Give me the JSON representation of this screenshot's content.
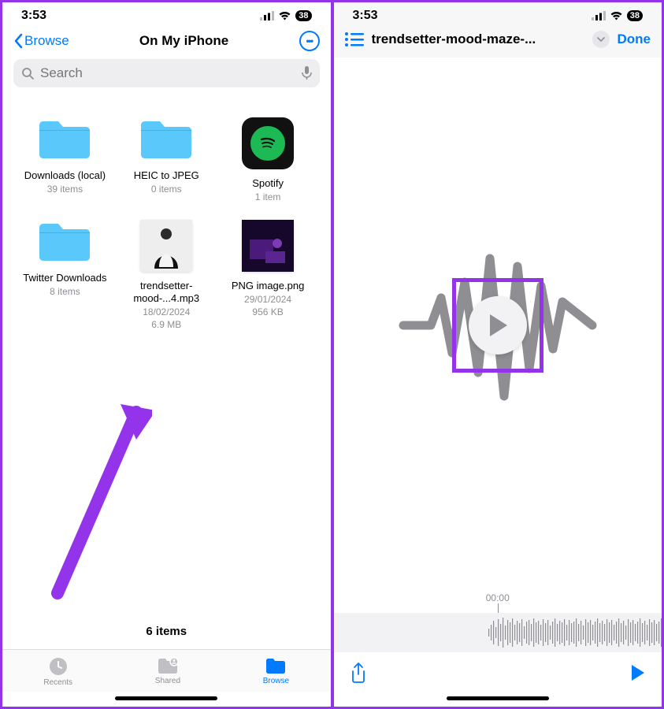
{
  "left": {
    "status": {
      "time": "3:53",
      "battery": "38"
    },
    "nav": {
      "back": "Browse",
      "title": "On My iPhone"
    },
    "search": {
      "placeholder": "Search"
    },
    "items": [
      {
        "name": "Downloads (local)",
        "sub": "39 items",
        "type": "folder"
      },
      {
        "name": "HEIC to JPEG",
        "sub": "0 items",
        "type": "folder"
      },
      {
        "name": "Spotify",
        "sub": "1 item",
        "type": "spotify"
      },
      {
        "name": "Twitter Downloads",
        "sub": "8 items",
        "type": "folder"
      },
      {
        "name": "trendsetter-mood-...4.mp3",
        "date": "18/02/2024",
        "size": "6.9 MB",
        "type": "audio"
      },
      {
        "name": "PNG image.png",
        "date": "29/01/2024",
        "size": "956 KB",
        "type": "image"
      }
    ],
    "footer": "6 items",
    "tabs": {
      "recents": "Recents",
      "shared": "Shared",
      "browse": "Browse"
    }
  },
  "right": {
    "status": {
      "time": "3:53",
      "battery": "38"
    },
    "nav": {
      "title": "trendsetter-mood-maze-...",
      "done": "Done"
    },
    "time": "00:00"
  }
}
